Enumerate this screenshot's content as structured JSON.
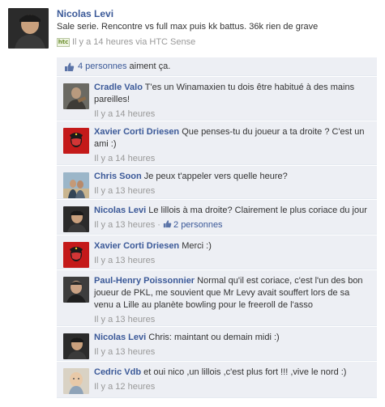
{
  "post": {
    "author": "Nicolas Levi",
    "text": "Sale serie. Rencontre vs full max puis kk battus. 36k rien de grave",
    "source_icon": "htc-icon",
    "source_icon_label": "htc",
    "timestamp": "Il y a 14 heures via HTC Sense"
  },
  "likes": {
    "icon": "thumbs-up-icon",
    "count_text": "4 personnes",
    "rest_text": "aiment ça."
  },
  "comments": [
    {
      "author": "Cradle Valo",
      "text": "T'es un Winamaxien tu dois être habitué à des mains pareilles!",
      "time": "Il y a 14 heures",
      "likes": ""
    },
    {
      "author": "Xavier Corti Driesen",
      "text": "Que penses-tu du joueur a ta droite ? C'est un ami :)",
      "time": "Il y a 14 heures",
      "likes": ""
    },
    {
      "author": "Chris Soon",
      "text": "Je peux t'appeler vers quelle heure?",
      "time": "Il y a 13 heures",
      "likes": ""
    },
    {
      "author": "Nicolas Levi",
      "text": "Le lillois à ma droite? Clairement le plus coriace du jour",
      "time": "Il y a 13 heures",
      "separator": "·",
      "likes": "2 personnes"
    },
    {
      "author": "Xavier Corti Driesen",
      "text": "Merci :)",
      "time": "Il y a 13 heures",
      "likes": ""
    },
    {
      "author": "Paul-Henry Poissonnier",
      "text": "Normal qu'il est coriace, c'est l'un des bon joueur de PKL, me souvient que Mr Levy avait souffert lors de sa venu a Lille au planète bowling pour le freeroll de l'asso",
      "time": "Il y a 13 heures",
      "likes": ""
    },
    {
      "author": "Nicolas Levi",
      "text": "Chris: maintant ou demain midi :)",
      "time": "Il y a 13 heures",
      "likes": ""
    },
    {
      "author": "Cedric Vdb",
      "text": "et oui nico ,un lillois ,c'est plus fort !!! ,vive le nord :)",
      "time": "Il y a 12 heures",
      "likes": ""
    }
  ],
  "colors": {
    "link": "#3b5998",
    "comment_bg": "#edeff4",
    "meta": "#999999"
  }
}
